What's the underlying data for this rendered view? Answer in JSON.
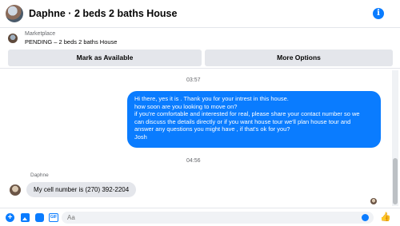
{
  "header": {
    "title": "Daphne · 2 beds 2 baths House",
    "info_icon": "i"
  },
  "listing": {
    "market_label": "Marketplace",
    "status_text": "PENDING – 2 beds 2 baths House",
    "mark_button": "Mark as Available",
    "more_button": "More Options"
  },
  "thread": {
    "time1": "03:57",
    "outgoing_lines": [
      "Hi there, yes it is . Thank you for your intrest in this house.",
      "how soon are you looking to move on?",
      "if you're comfortable and interested for real, please share your contact number so we",
      "can discuss the details directly or if you  want house tour we'll plan house tour and",
      "answer any questions you might have , if that's ok for you?",
      "Josh"
    ],
    "time2": "04:56",
    "sender": "Daphne",
    "incoming": "My cell number is (270) 392-2204"
  },
  "composer": {
    "placeholder": "Aa",
    "plus_glyph": "+",
    "gif_label": "GIF",
    "like_glyph": "👍"
  },
  "colors": {
    "accent": "#0a7cff",
    "bubble_in": "#e4e6eb"
  }
}
